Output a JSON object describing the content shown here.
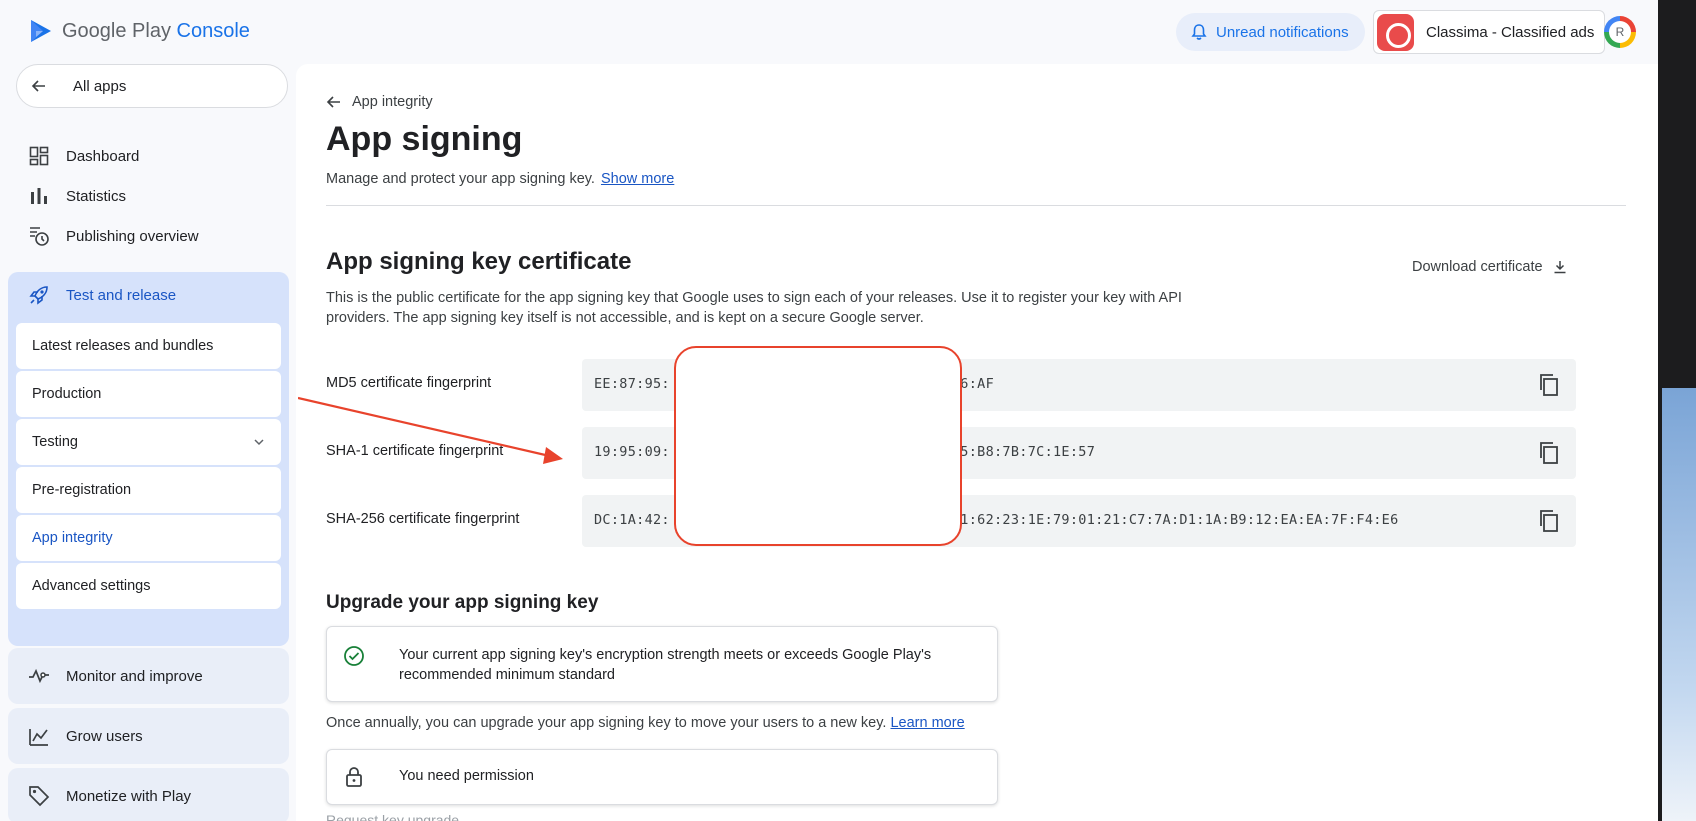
{
  "brand": {
    "name_prefix": "Google Play",
    "name_suffix": "Console"
  },
  "topbar": {
    "notifications_label": "Unread notifications",
    "app_name": "Classima - Classified ads",
    "avatar_letter": "R"
  },
  "sidebar": {
    "all_apps": "All apps",
    "items": [
      {
        "label": "Dashboard"
      },
      {
        "label": "Statistics"
      },
      {
        "label": "Publishing overview"
      }
    ],
    "group": {
      "label": "Test and release",
      "children": [
        {
          "label": "Latest releases and bundles"
        },
        {
          "label": "Production"
        },
        {
          "label": "Testing"
        },
        {
          "label": "Pre-registration"
        },
        {
          "label": "App integrity"
        },
        {
          "label": "Advanced settings"
        }
      ]
    },
    "collapsed": [
      {
        "label": "Monitor and improve"
      },
      {
        "label": "Grow users"
      },
      {
        "label": "Monetize with Play"
      }
    ]
  },
  "main": {
    "breadcrumb": "App integrity",
    "title": "App signing",
    "subtitle": "Manage and protect your app signing key.",
    "show_more": "Show more",
    "cert": {
      "title": "App signing key certificate",
      "download": "Download certificate",
      "description": "This is the public certificate for the app signing key that Google uses to sign each of your releases. Use it to register your key with API providers. The app signing key itself is not accessible, and is kept on a secure Google server.",
      "fingerprints": [
        {
          "label": "MD5 certificate fingerprint",
          "value_start": "EE:87:95:",
          "value_end": "96:AF"
        },
        {
          "label": "SHA-1 certificate fingerprint",
          "value_start": "19:95:09:",
          "value_end": "15:B8:7B:7C:1E:57"
        },
        {
          "label": "SHA-256 certificate fingerprint",
          "value_start": "DC:1A:42:",
          "value_end": "31:62:23:1E:79:01:21:C7:7A:D1:1A:B9:12:EA:EA:7F:F4:E6"
        }
      ]
    },
    "upgrade": {
      "title": "Upgrade your app signing key",
      "status_text": "Your current app signing key's encryption strength meets or exceeds Google Play's recommended minimum standard",
      "info_text": "Once annually, you can upgrade your app signing key to move your users to a new key.",
      "learn_more": "Learn more",
      "permission_text": "You need permission",
      "request_label": "Request key upgrade"
    }
  },
  "colors": {
    "accent": "#1a56c4",
    "active_group_bg": "#d6e2fb",
    "annotation_red": "#e8432c",
    "success": "#188038"
  }
}
